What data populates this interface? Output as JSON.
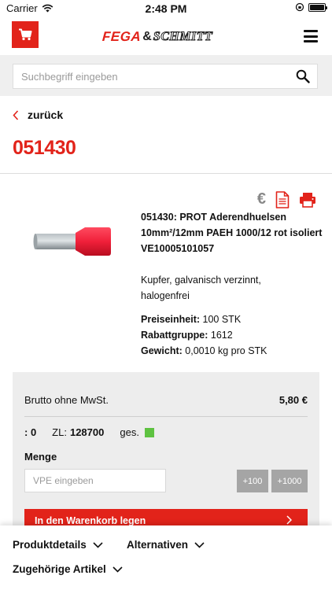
{
  "status_bar": {
    "carrier": "Carrier",
    "time": "2:48 PM"
  },
  "header": {
    "logo_left": "FEGA",
    "logo_amp": "&",
    "logo_right": "SCHMITT"
  },
  "search": {
    "placeholder": "Suchbegriff eingeben"
  },
  "nav": {
    "back_label": "zurück"
  },
  "product": {
    "number": "051430",
    "name_lines": [
      "051430: PROT Aderendhuelsen",
      "10mm²/12mm PAEH 1000/12 rot isoliert",
      "VE10005101057"
    ],
    "material": [
      "Kupfer, galvanisch verzinnt,",
      "halogenfrei"
    ],
    "price_unit_label": "Preiseinheit:",
    "price_unit_value": "100 STK",
    "discount_label": "Rabattgruppe:",
    "discount_value": "1612",
    "weight_label": "Gewicht:",
    "weight_value": "0,0010 kg pro STK",
    "icons": [
      "euro-icon",
      "document-icon",
      "print-icon"
    ]
  },
  "pricing": {
    "gross_label": "Brutto ohne MwSt.",
    "gross_value": "5,80 €",
    "stock_prefix": ": 0",
    "zl_label": "ZL:",
    "zl_value": "128700",
    "ges_label": "ges.",
    "quantity_label": "Menge",
    "vpe_placeholder": "VPE eingeben",
    "btn_plus100": "+100",
    "btn_plus1000": "+1000",
    "add_to_cart": "In den Warenkorb legen"
  },
  "bottom_tabs": {
    "details": "Produktdetails",
    "alternatives": "Alternativen",
    "related": "Zugehörige Artikel"
  },
  "colors": {
    "accent": "#e2231a",
    "stock_ok": "#5ec241",
    "panel": "#ededed"
  }
}
